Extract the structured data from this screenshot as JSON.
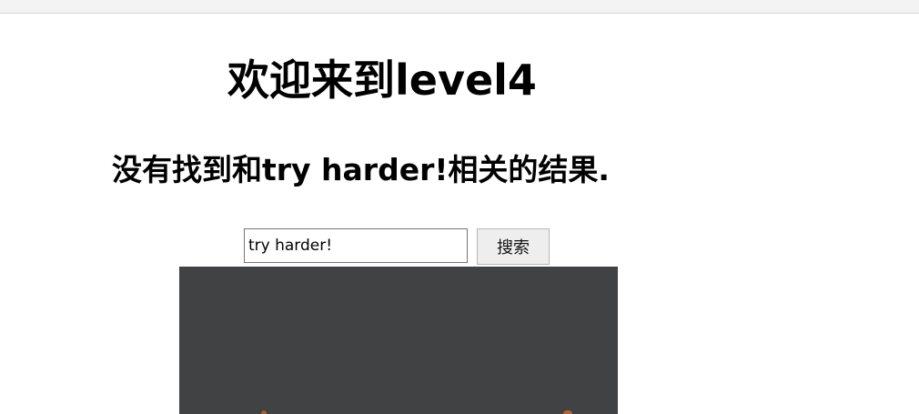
{
  "page": {
    "heading": "欢迎来到level4",
    "result_message": "没有找到和try harder!相关的结果."
  },
  "search": {
    "value": "try harder!",
    "button_label": "搜索"
  },
  "colors": {
    "background": "#ffffff",
    "browser_bar": "#f3f3f3",
    "input_border": "#767676",
    "button_background": "#eeeeee",
    "preview_panel": "#414244",
    "preview_accent": "#b9642f"
  }
}
